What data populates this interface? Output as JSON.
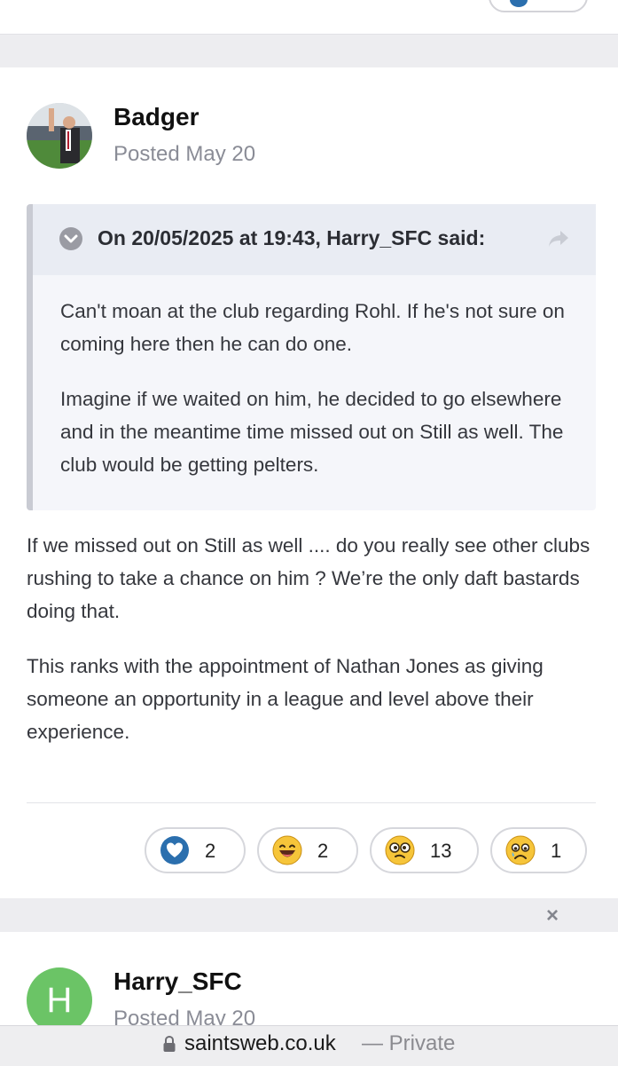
{
  "post": {
    "author": "Badger",
    "posted": "Posted May 20",
    "quote": {
      "attribution": "On 20/05/2025 at 19:43, Harry_SFC said:",
      "paragraphs": [
        "Can't moan at the club regarding Rohl. If he's not sure on coming here then he can do one.",
        "Imagine if we waited on him, he decided to go elsewhere and in the meantime time missed out on Still as well. The club would be getting pelters."
      ]
    },
    "paragraphs": [
      "If we missed out on Still as well .... do you really see other clubs rushing to take a chance on him ? We’re the only daft bastards doing that.",
      "This ranks with the appointment of Nathan Jones as giving someone an opportunity in a league and level above their experience."
    ],
    "reactions": [
      {
        "icon": "heart-icon",
        "count": "2"
      },
      {
        "icon": "laughing-face-icon",
        "count": "2"
      },
      {
        "icon": "confused-face-icon",
        "count": "13"
      },
      {
        "icon": "sad-face-icon",
        "count": "1"
      }
    ]
  },
  "close_label": "×",
  "next_post": {
    "avatar_letter": "H",
    "author": "Harry_SFC",
    "posted": "Posted May 20"
  },
  "browser": {
    "domain": "saintsweb.co.uk",
    "mode": "— Private"
  },
  "colors": {
    "accent_blue": "#2b6fae",
    "emoji_yellow": "#f6c53a",
    "avatar_green": "#6bc466",
    "muted_text": "#8a8c96"
  }
}
